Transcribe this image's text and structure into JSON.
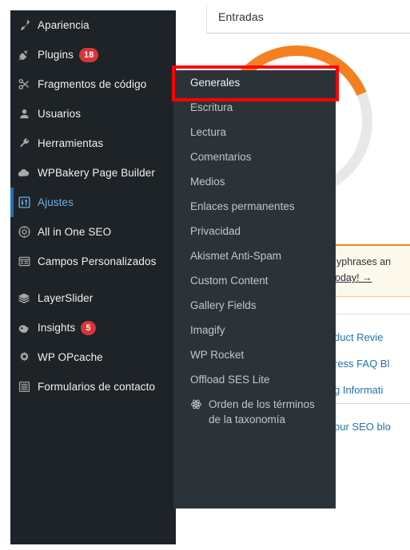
{
  "content": {
    "tab_label": "Entradas",
    "notice": {
      "line1": "yphrases an",
      "line2": "oday! →"
    },
    "links": [
      "duct Revie",
      "ress FAQ Bl",
      "g Informati",
      "our SEO blo"
    ]
  },
  "sidebar": {
    "items": [
      {
        "label": "Apariencia",
        "icon": "brush-icon",
        "badge": ""
      },
      {
        "label": "Plugins",
        "icon": "plug-icon",
        "badge": "18"
      },
      {
        "label": "Fragmentos de código",
        "icon": "scissors-icon",
        "badge": ""
      },
      {
        "label": "Usuarios",
        "icon": "user-icon",
        "badge": ""
      },
      {
        "label": "Herramientas",
        "icon": "wrench-icon",
        "badge": ""
      },
      {
        "label": "WPBakery Page Builder",
        "icon": "cloud-icon",
        "badge": ""
      },
      {
        "label": "Ajustes",
        "icon": "sliders-icon",
        "badge": "",
        "active": true
      },
      {
        "label": "All in One SEO",
        "icon": "aioseo-icon",
        "badge": ""
      },
      {
        "label": "Campos Personalizados",
        "icon": "acf-icon",
        "badge": ""
      },
      {
        "label": "LayerSlider",
        "icon": "layers-icon",
        "badge": "",
        "gap_before": true
      },
      {
        "label": "Insights",
        "icon": "monsterinsights-icon",
        "badge": "5"
      },
      {
        "label": "WP OPcache",
        "icon": "gear-icon",
        "badge": ""
      },
      {
        "label": "Formularios de contacto",
        "icon": "list-icon",
        "badge": ""
      }
    ]
  },
  "submenu": {
    "items": [
      {
        "label": "Generales",
        "current": true
      },
      {
        "label": "Escritura"
      },
      {
        "label": "Lectura"
      },
      {
        "label": "Comentarios"
      },
      {
        "label": "Medios"
      },
      {
        "label": "Enlaces permanentes"
      },
      {
        "label": "Privacidad"
      },
      {
        "label": "Akismet Anti-Spam"
      },
      {
        "label": "Custom Content"
      },
      {
        "label": "Gallery Fields"
      },
      {
        "label": "Imagify"
      },
      {
        "label": "WP Rocket"
      },
      {
        "label": "Offload SES Lite"
      },
      {
        "label": "Orden de los términos de la taxonomía",
        "icon": "atom-icon",
        "multiline": true
      }
    ]
  },
  "annotation": {
    "highlight_color": "#ff0000",
    "target": "Generales"
  },
  "colors": {
    "sidebar_bg": "#1d2327",
    "submenu_bg": "#2c3338",
    "accent_blue": "#2271b1",
    "badge_red": "#d63638",
    "notice_orange": "#f0861a"
  }
}
